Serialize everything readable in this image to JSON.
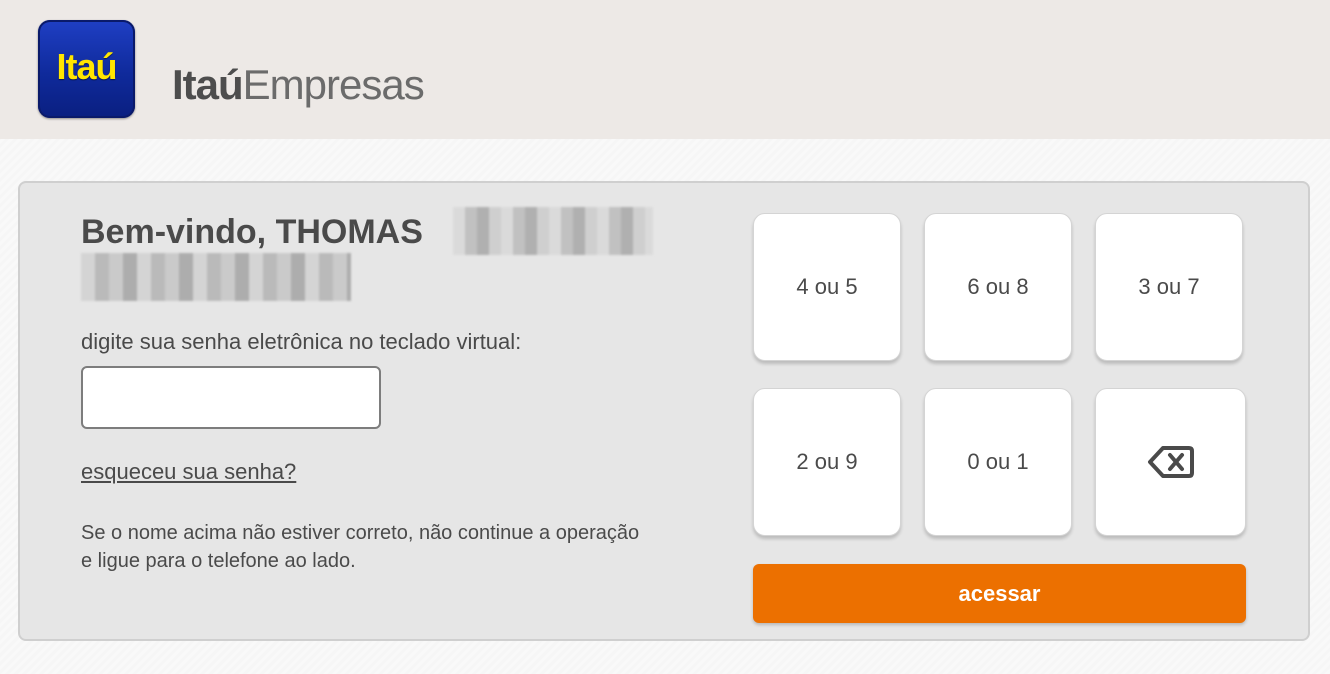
{
  "header": {
    "logo_text": "Itaú",
    "brand_bold": "Itaú",
    "brand_light": "Empresas"
  },
  "login": {
    "greeting": "Bem-vindo, THOMAS",
    "prompt": "digite sua senha eletrônica no teclado virtual:",
    "password_value": "",
    "forgot_link": "esqueceu sua senha?",
    "notice": "Se o nome acima não estiver correto, não continue a operação e ligue para o telefone ao lado."
  },
  "keypad": {
    "keys": [
      "4 ou 5",
      "6 ou 8",
      "3 ou 7",
      "2 ou 9",
      "0 ou 1"
    ],
    "backspace_icon": "backspace-icon",
    "submit_label": "acessar"
  },
  "colors": {
    "logo_blue": "#0f2a9b",
    "logo_yellow": "#ffe600",
    "submit_orange": "#ec7000"
  }
}
